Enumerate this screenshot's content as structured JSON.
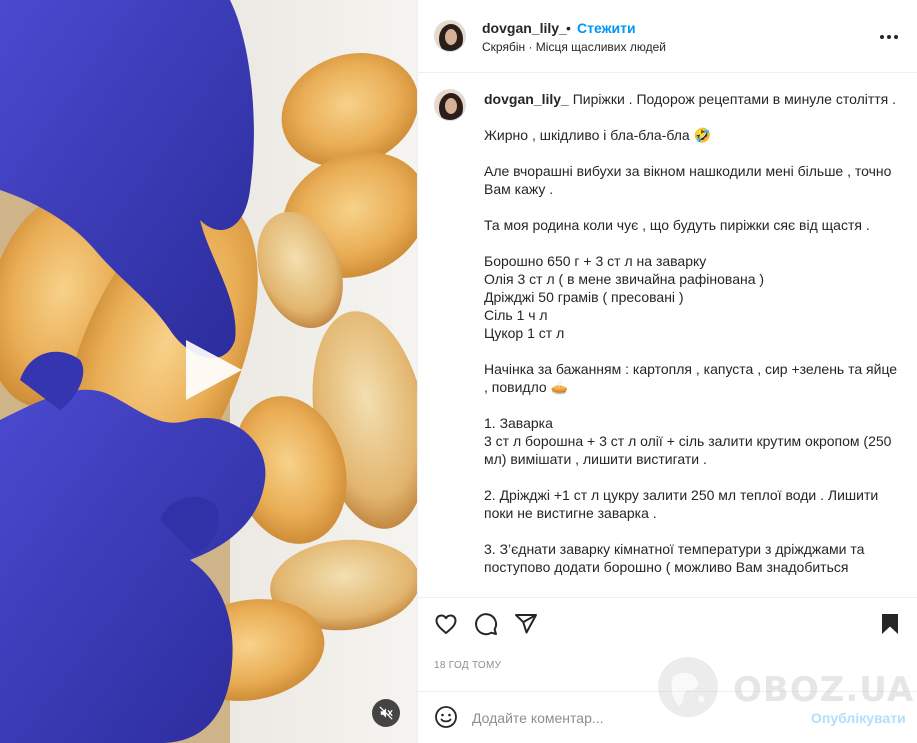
{
  "post": {
    "username": "dovgan_lily_",
    "separator": "•",
    "follow_label": "Стежити",
    "audio": "Скрябін",
    "audio_separator": " · ",
    "audio_track": "Місця щасливих людей",
    "caption": "Пиріжки . Подорож рецептами в минуле століття .\n\nЖирно , шкідливо і бла-бла-бла 🤣\n\nАле вчорашні вибухи за вікном нашкодили мені більше , точно Вам кажу .\n\nТа моя родина коли чує , що будуть пиріжки сяє від щастя .\n\nБорошно 650 г + 3 ст л на заварку\nОлія 3 ст л ( в мене звичайна рафінована )\nДріжджі 50 грамів ( пресовані )\nСіль 1 ч л\nЦукор 1 ст л\n\nНачінка за бажанням : картопля , капуста , сир +зелень та яйце , повидло 🥧\n\n1. Заварка\n3 ст л борошна + 3 ст л олії + сіль залити крутим окропом (250 мл) вимішати , лишити вистигати .\n\n2. Дріжджі +1 ст л цукру залити 250 мл теплої води . Лишити поки не вистигне заварка .\n\n3. З’єднати заварку кімнатної температури з дріжджами та поступово додати борошно ( можливо Вам знадобиться",
    "timestamp": "18 ГОД ТОМУ"
  },
  "comment": {
    "placeholder": "Додайте коментар...",
    "publish_label": "Опублікувати"
  },
  "icons": {
    "play": "play-icon",
    "mute": "muted-speaker-icon",
    "more": "more-options-icon",
    "like": "heart-icon",
    "comment": "comment-icon",
    "share": "paper-plane-icon",
    "save": "bookmark-icon",
    "emoji": "smiley-icon"
  },
  "colors": {
    "accent": "#0095f6",
    "publish_disabled": "#b2dffc",
    "glove": "#3f3fc0",
    "muted_text": "#8e8e8e"
  },
  "watermark": {
    "text": "OBOZ.UA"
  }
}
